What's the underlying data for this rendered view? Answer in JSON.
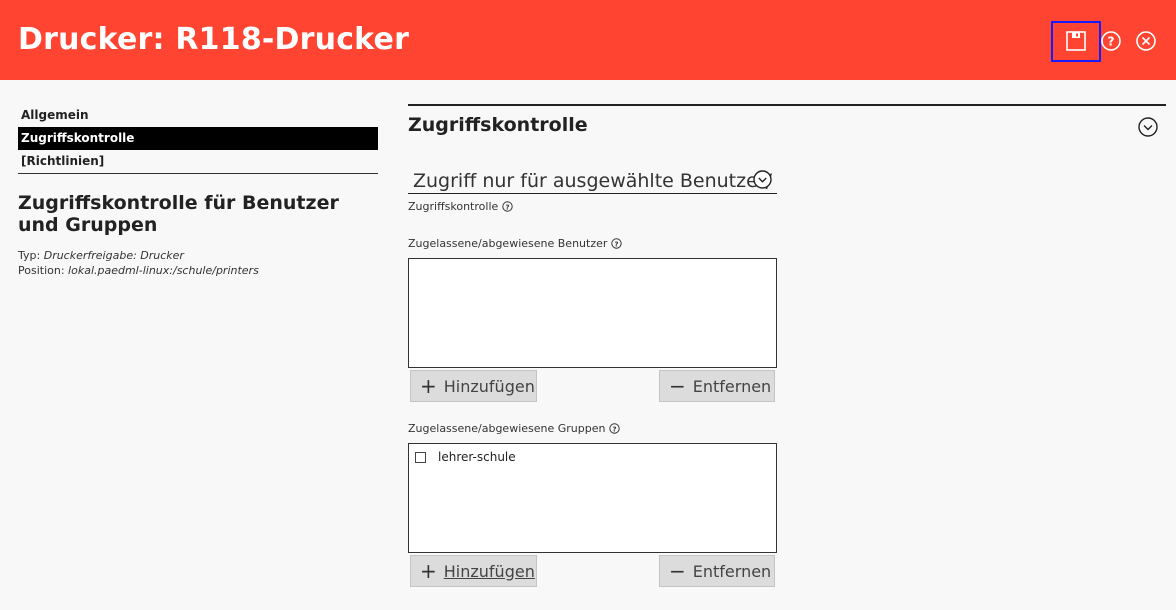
{
  "header": {
    "title": "Drucker: R118-Drucker",
    "icons": [
      "save-icon",
      "help-icon",
      "close-icon"
    ],
    "color": "#ff4532"
  },
  "nav": {
    "items": [
      {
        "label": "Allgemein",
        "active": false
      },
      {
        "label": "Zugriffskontrolle",
        "active": true
      },
      {
        "label": "[Richtlinien]",
        "active": false
      }
    ]
  },
  "module": {
    "title": "Zugriffskontrolle für Benutzer und Gruppen",
    "typ_label": "Typ:",
    "typ_value": "Druckerfreigabe: Drucker",
    "position_label": "Position:",
    "position_value": "lokal.paedml-linux:/schule/printers"
  },
  "section": {
    "title": "Zugriffskontrolle",
    "access_select": {
      "value": "Zugriff nur für ausgewählte Benutzer/",
      "label": "Zugriffskontrolle"
    },
    "users": {
      "label": "Zugelassene/abgewiesene Benutzer",
      "items": [],
      "add_label": "Hinzufügen",
      "remove_label": "Entfernen"
    },
    "groups": {
      "label": "Zugelassene/abgewiesene Gruppen",
      "items": [
        {
          "label": "lehrer-schule",
          "checked": false
        }
      ],
      "add_label": "Hinzufügen",
      "remove_label": "Entfernen"
    }
  }
}
